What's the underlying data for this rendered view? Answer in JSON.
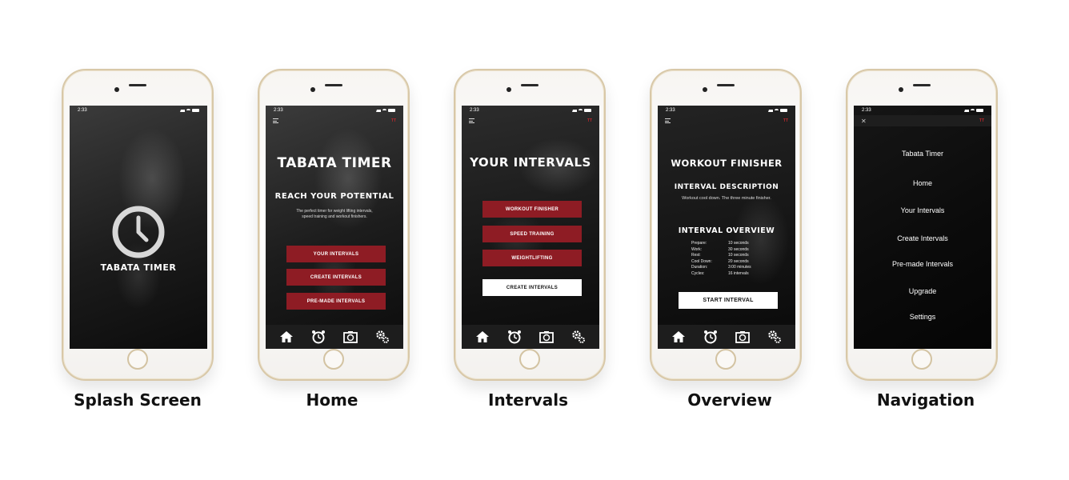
{
  "status_time": "2:33",
  "brand_mark": "TT",
  "accent_color": "#8e1c24",
  "captions": [
    "Splash Screen",
    "Home",
    "Intervals",
    "Overview",
    "Navigation"
  ],
  "splash": {
    "title": "TABATA TIMER",
    "icon": "clock-icon"
  },
  "home": {
    "title": "TABATA TIMER",
    "subtitle": "REACH YOUR POTENTIAL",
    "description": "The perfect timer for weight lifting intervals, speed training and workout finishers.",
    "buttons": [
      "YOUR INTERVALS",
      "CREATE INTERVALS",
      "PRE-MADE INTERVALS"
    ]
  },
  "intervals": {
    "title": "YOUR INTERVALS",
    "items": [
      "WORKOUT FINISHER",
      "SPEED TRAINING",
      "WEIGHTLIFTING"
    ],
    "create_button": "CREATE INTERVALS"
  },
  "overview": {
    "title": "WORKOUT FINISHER",
    "desc_heading": "INTERVAL DESCRIPTION",
    "desc_text": "Workout cool down. The three minute finisher.",
    "overview_heading": "INTERVAL OVERVIEW",
    "rows": [
      {
        "label": "Prepare:",
        "value": "10 seconds"
      },
      {
        "label": "Work:",
        "value": "30 seconds"
      },
      {
        "label": "Rest:",
        "value": "10 seconds"
      },
      {
        "label": "Cool Down:",
        "value": "20 seconds"
      },
      {
        "label": "Duration:",
        "value": "3:00 minutes"
      },
      {
        "label": "Cycles:",
        "value": "16 intervals"
      }
    ],
    "start_button": "START INTERVAL"
  },
  "navigation": {
    "items": [
      "Tabata Timer",
      "Home",
      "Your Intervals",
      "Create Intervals",
      "Pre-made Intervals",
      "Upgrade",
      "Settings"
    ]
  },
  "tabs": [
    "home-icon",
    "alarm-clock-icon",
    "timer-camera-icon",
    "settings-gears-icon"
  ]
}
